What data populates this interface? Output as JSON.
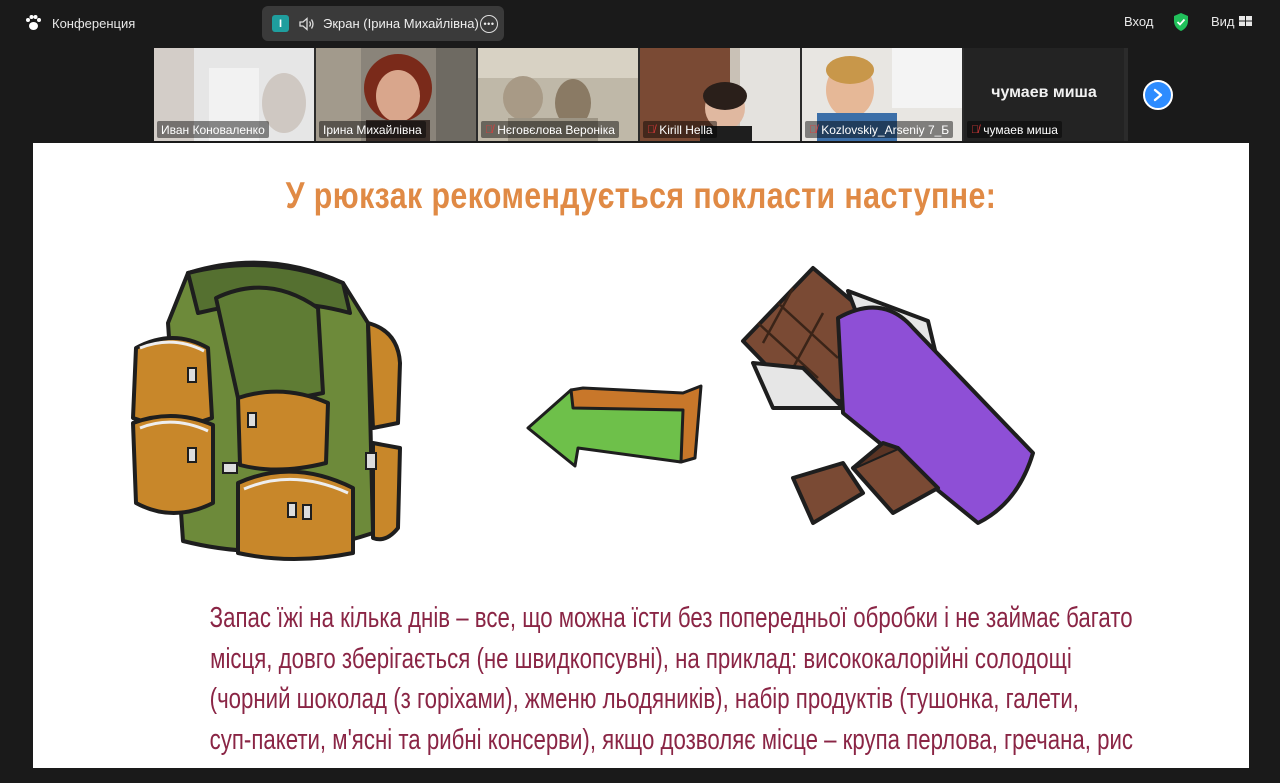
{
  "topbar": {
    "app_label": "Конференция",
    "share_badge": "I",
    "share_title": "Экран (Ірина Михайлівна)",
    "login_label": "Вход",
    "view_label": "Вид"
  },
  "participants": [
    {
      "name": "Иван Коноваленко",
      "muted": false,
      "active": false
    },
    {
      "name": "Ірина Михайлівна",
      "muted": false,
      "active": true
    },
    {
      "name": "Нєговєлова Вероніка",
      "muted": true,
      "active": false
    },
    {
      "name": "Kirill Hella",
      "muted": true,
      "active": false
    },
    {
      "name": "Kozlovskiy_Arseniy 7_Б",
      "muted": true,
      "active": false
    },
    {
      "name": "чумаев миша",
      "muted": true,
      "active": false,
      "display_text": "чумаев миша"
    }
  ],
  "slide": {
    "title": "У рюкзак рекомендується покласти наступне:",
    "lines": [
      "Запас їжі на кілька днів – все, що можна їсти без попередньої обробки і не займає багато",
      "місця, довго зберігається (не швидкопсувні), на приклад: висококалорійні солодощі",
      "(чорний шоколад (з горіхами), жменю льодяників), набір продуктів (тушонка, галети,",
      "суп-пакети, м'ясні та рибні консерви), якщо дозволяє місце – крупа перлова, гречана, рис"
    ]
  },
  "colors": {
    "accent_green": "#1fd07a",
    "title_orange": "#e08a45",
    "text_maroon": "#8a2545",
    "next_blue": "#2d8cff"
  }
}
